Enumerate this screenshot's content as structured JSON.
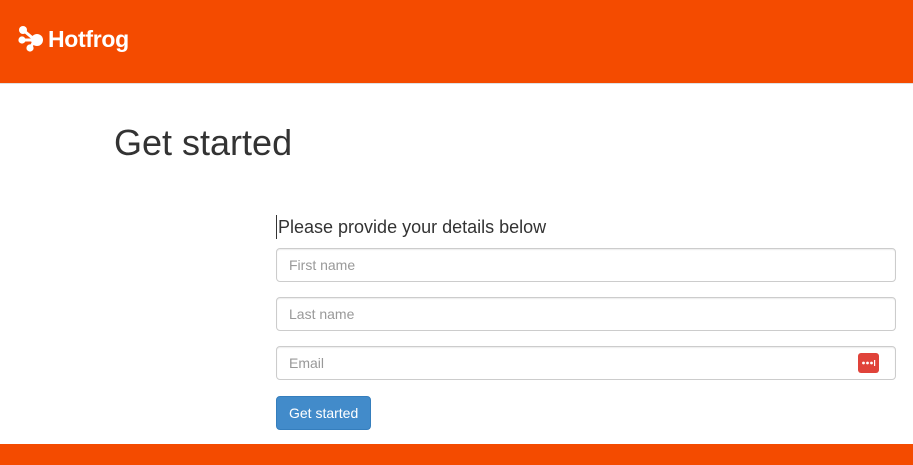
{
  "header": {
    "logo_text": "Hotfrog",
    "logo_icon": "frog-paw-icon",
    "background_color": "#f44b00"
  },
  "main": {
    "title": "Get started",
    "intro": "Please provide your details below"
  },
  "form": {
    "first_name": {
      "placeholder": "First name",
      "value": ""
    },
    "last_name": {
      "placeholder": "Last name",
      "value": ""
    },
    "email": {
      "placeholder": "Email",
      "value": "",
      "icon": "password-manager-icon"
    },
    "submit_label": "Get started",
    "submit_color": "#428bca"
  },
  "footer": {
    "background_color": "#f44b00"
  }
}
